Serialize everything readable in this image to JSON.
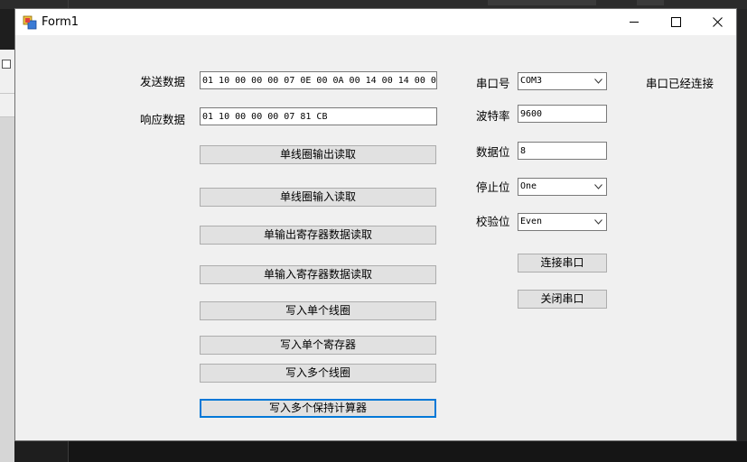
{
  "window": {
    "title": "Form1"
  },
  "send": {
    "label": "发送数据",
    "value": "01 10 00 00 00 07 0E 00 0A 00 14 00 14 00 0"
  },
  "response": {
    "label": "响应数据",
    "value": "01 10 00 00 00 07 81 CB"
  },
  "buttons": {
    "read_single_coil_output": "单线圈输出读取",
    "read_single_coil_input": "单线圈输入读取",
    "read_output_register": "单输出寄存器数据读取",
    "read_input_register": "单输入寄存器数据读取",
    "write_single_coil": "写入单个线圈",
    "write_single_register": "写入单个寄存器",
    "write_multiple_coils": "写入多个线圈",
    "write_multiple_holding": "写入多个保持计算器",
    "connect": "连接串口",
    "close": "关闭串口"
  },
  "serial": {
    "port_label": "串口号",
    "port_value": "COM3",
    "baud_label": "波特率",
    "baud_value": "9600",
    "databits_label": "数据位",
    "databits_value": "8",
    "stopbits_label": "停止位",
    "stopbits_value": "One",
    "parity_label": "校验位",
    "parity_value": "Even",
    "status": "串口已经连接"
  }
}
